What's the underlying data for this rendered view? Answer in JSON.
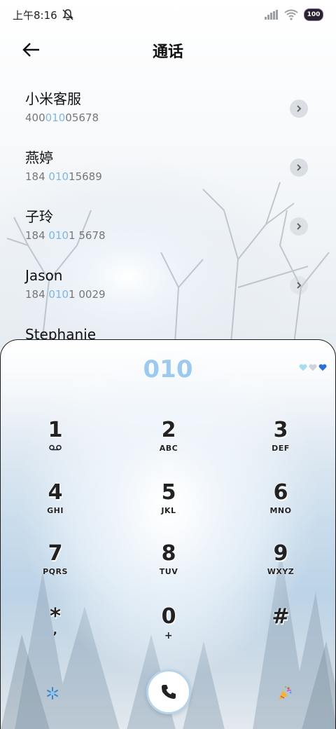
{
  "status": {
    "time": "上午8:16",
    "battery": "100"
  },
  "header": {
    "title": "通话"
  },
  "contacts": [
    {
      "name": "小米客服",
      "num_pre": "400",
      "num_hl": "010",
      "num_post": "05678"
    },
    {
      "name": "燕婷",
      "num_pre": "184 ",
      "num_hl": "010",
      "num_post": "15689"
    },
    {
      "name": "子玲",
      "num_pre": "184 ",
      "num_hl": "010",
      "num_post": "1 5678"
    },
    {
      "name": "Jason",
      "num_pre": "184 ",
      "num_hl": "010",
      "num_post": "1 0029"
    },
    {
      "name": "Stephanie",
      "num_pre": "",
      "num_hl": "",
      "num_post": ""
    }
  ],
  "dialpad": {
    "display": "010",
    "keys": [
      {
        "digit": "1",
        "letters": ""
      },
      {
        "digit": "2",
        "letters": "ABC"
      },
      {
        "digit": "3",
        "letters": "DEF"
      },
      {
        "digit": "4",
        "letters": "GHI"
      },
      {
        "digit": "5",
        "letters": "JKL"
      },
      {
        "digit": "6",
        "letters": "MNO"
      },
      {
        "digit": "7",
        "letters": "PQRS"
      },
      {
        "digit": "8",
        "letters": "TUV"
      },
      {
        "digit": "9",
        "letters": "WXYZ"
      },
      {
        "digit": "*",
        "letters": ","
      },
      {
        "digit": "0",
        "letters": "+"
      },
      {
        "digit": "#",
        "letters": ""
      }
    ]
  },
  "colors": {
    "accent": "#9ec9ee",
    "highlight": "#7fb6e3",
    "text": "#111111"
  }
}
